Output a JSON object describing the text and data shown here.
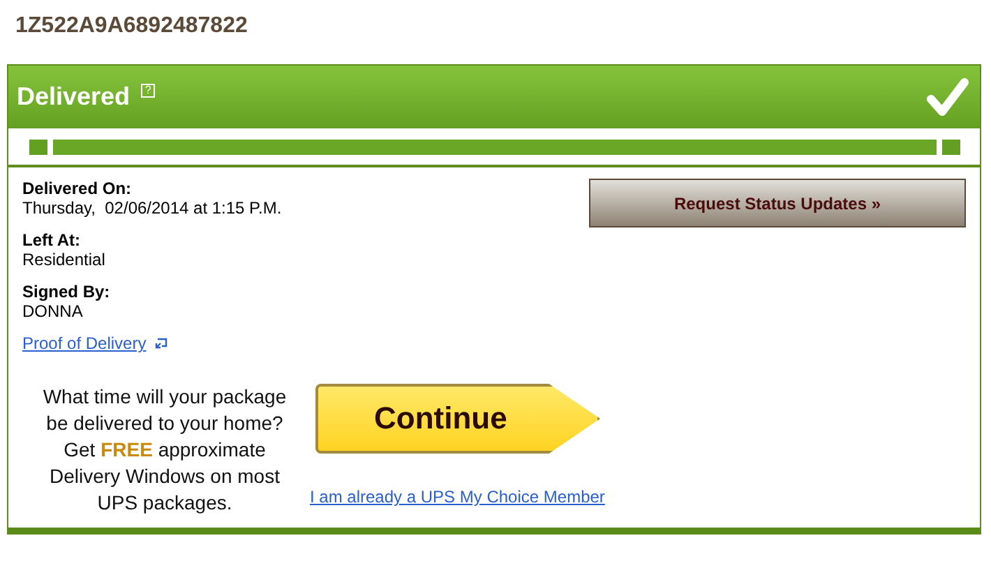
{
  "tracking_number": "1Z522A9A6892487822",
  "status": {
    "title": "Delivered",
    "help": "?",
    "delivered": true
  },
  "details": [
    {
      "label": "Delivered On:",
      "value": "Thursday,  02/06/2014 at 1:15 P.M."
    },
    {
      "label": "Left At:",
      "value": "Residential"
    },
    {
      "label": "Signed By:",
      "value": "DONNA"
    }
  ],
  "proof_link": "Proof of Delivery",
  "request_button": "Request Status Updates »",
  "promo": {
    "text": "What time will your package be delivered to your home? Get **FREE** approximate Delivery Windows on most UPS packages.",
    "button": "Continue",
    "member_link": "I am already a UPS My Choice Member"
  }
}
